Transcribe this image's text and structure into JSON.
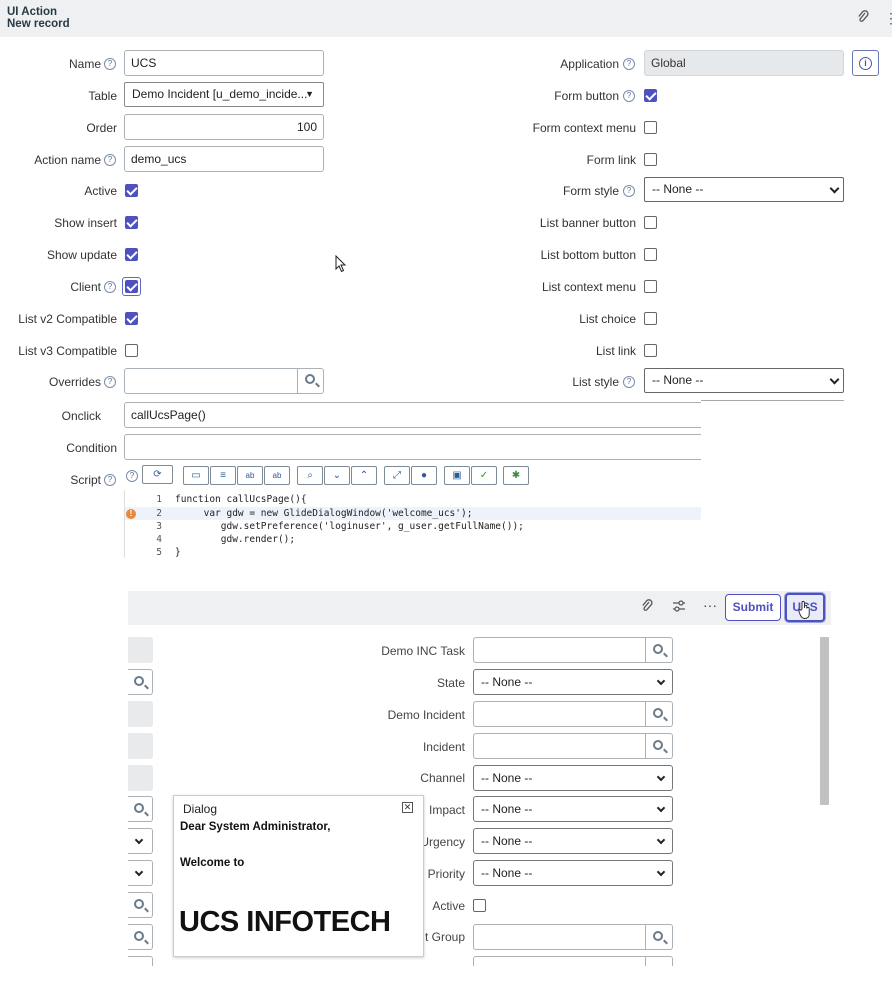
{
  "header": {
    "title": "UI Action",
    "subtitle": "New record"
  },
  "left_fields": {
    "name": {
      "label": "Name",
      "value": "UCS"
    },
    "table": {
      "label": "Table",
      "value": "Demo Incident [u_demo_incide..."
    },
    "order": {
      "label": "Order",
      "value": "100"
    },
    "action_name": {
      "label": "Action name",
      "value": "demo_ucs"
    },
    "active": {
      "label": "Active",
      "checked": true
    },
    "show_insert": {
      "label": "Show insert",
      "checked": true
    },
    "show_update": {
      "label": "Show update",
      "checked": true
    },
    "client": {
      "label": "Client",
      "checked": true
    },
    "list_v2": {
      "label": "List v2 Compatible",
      "checked": true
    },
    "list_v3": {
      "label": "List v3 Compatible",
      "checked": false
    },
    "overrides": {
      "label": "Overrides",
      "value": ""
    },
    "onclick": {
      "label": "Onclick",
      "value": "callUcsPage()"
    },
    "condition": {
      "label": "Condition",
      "value": ""
    },
    "script": {
      "label": "Script"
    }
  },
  "right_fields": {
    "application": {
      "label": "Application",
      "value": "Global"
    },
    "form_button": {
      "label": "Form button",
      "checked": true
    },
    "form_context_menu": {
      "label": "Form context menu",
      "checked": false
    },
    "form_link": {
      "label": "Form link",
      "checked": false
    },
    "form_style": {
      "label": "Form style",
      "value": "-- None --"
    },
    "list_banner_button": {
      "label": "List banner button",
      "checked": false
    },
    "list_bottom_button": {
      "label": "List bottom button",
      "checked": false
    },
    "list_context_menu": {
      "label": "List context menu",
      "checked": false
    },
    "list_choice": {
      "label": "List choice",
      "checked": false
    },
    "list_link": {
      "label": "List link",
      "checked": false
    },
    "list_style": {
      "label": "List style",
      "value": "-- None --"
    }
  },
  "script_lines": [
    {
      "n": "1",
      "text": "function callUcsPage(){"
    },
    {
      "n": "2",
      "text": "     var gdw = new GlideDialogWindow('welcome_ucs');"
    },
    {
      "n": "3",
      "text": "        gdw.setPreference('loginuser', g_user.getFullName());"
    },
    {
      "n": "4",
      "text": "        gdw.render();"
    },
    {
      "n": "5",
      "text": "}"
    }
  ],
  "bottom_form": {
    "submit_label": "Submit",
    "ucs_label": "UCS",
    "fields": {
      "demo_inc_task": "Demo INC Task",
      "state": "State",
      "demo_incident": "Demo Incident",
      "incident": "Incident",
      "channel": "Channel",
      "impact": "Impact",
      "urgency": "Urgency",
      "priority": "Priority",
      "active": "Active",
      "group": "t Group"
    },
    "none_option": "-- None --"
  },
  "dialog": {
    "title": "Dialog",
    "greeting": "Dear System Administrator,",
    "welcome": "Welcome to",
    "brand": "UCS INFOTECH"
  },
  "colors": {
    "accent": "#4f52bd",
    "header_bg": "#eef0f1",
    "link_blue": "#2a5c9a"
  }
}
